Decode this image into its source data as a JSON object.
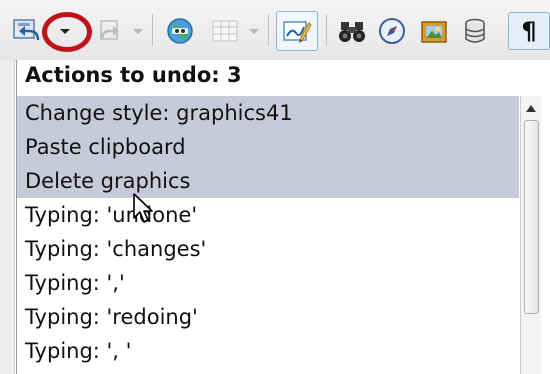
{
  "toolbar": {
    "items": [
      {
        "name": "undo-icon"
      },
      {
        "name": "undo-dropdown-arrow"
      },
      {
        "name": "redo-icon"
      },
      {
        "name": "redo-dropdown-arrow"
      },
      {
        "name": "navigator-icon"
      },
      {
        "name": "table-icon"
      },
      {
        "name": "table-dropdown-arrow"
      },
      {
        "name": "show-draw-functions-icon"
      },
      {
        "name": "find-replace-icon"
      },
      {
        "name": "navigator-compass-icon"
      },
      {
        "name": "gallery-icon"
      },
      {
        "name": "data-sources-icon"
      },
      {
        "name": "formatting-marks-icon"
      }
    ],
    "highlight_color": "#c0121a"
  },
  "undo_popup": {
    "title": "Actions to undo: 3",
    "items": [
      "Change style: graphics41",
      "Paste clipboard",
      "Delete graphics",
      "Typing: 'undone'",
      "Typing: 'changes'",
      "Typing: ','",
      "Typing: 'redoing'",
      "Typing: ', '"
    ],
    "selected_count": 3,
    "selection_color": "#c9cad9"
  }
}
